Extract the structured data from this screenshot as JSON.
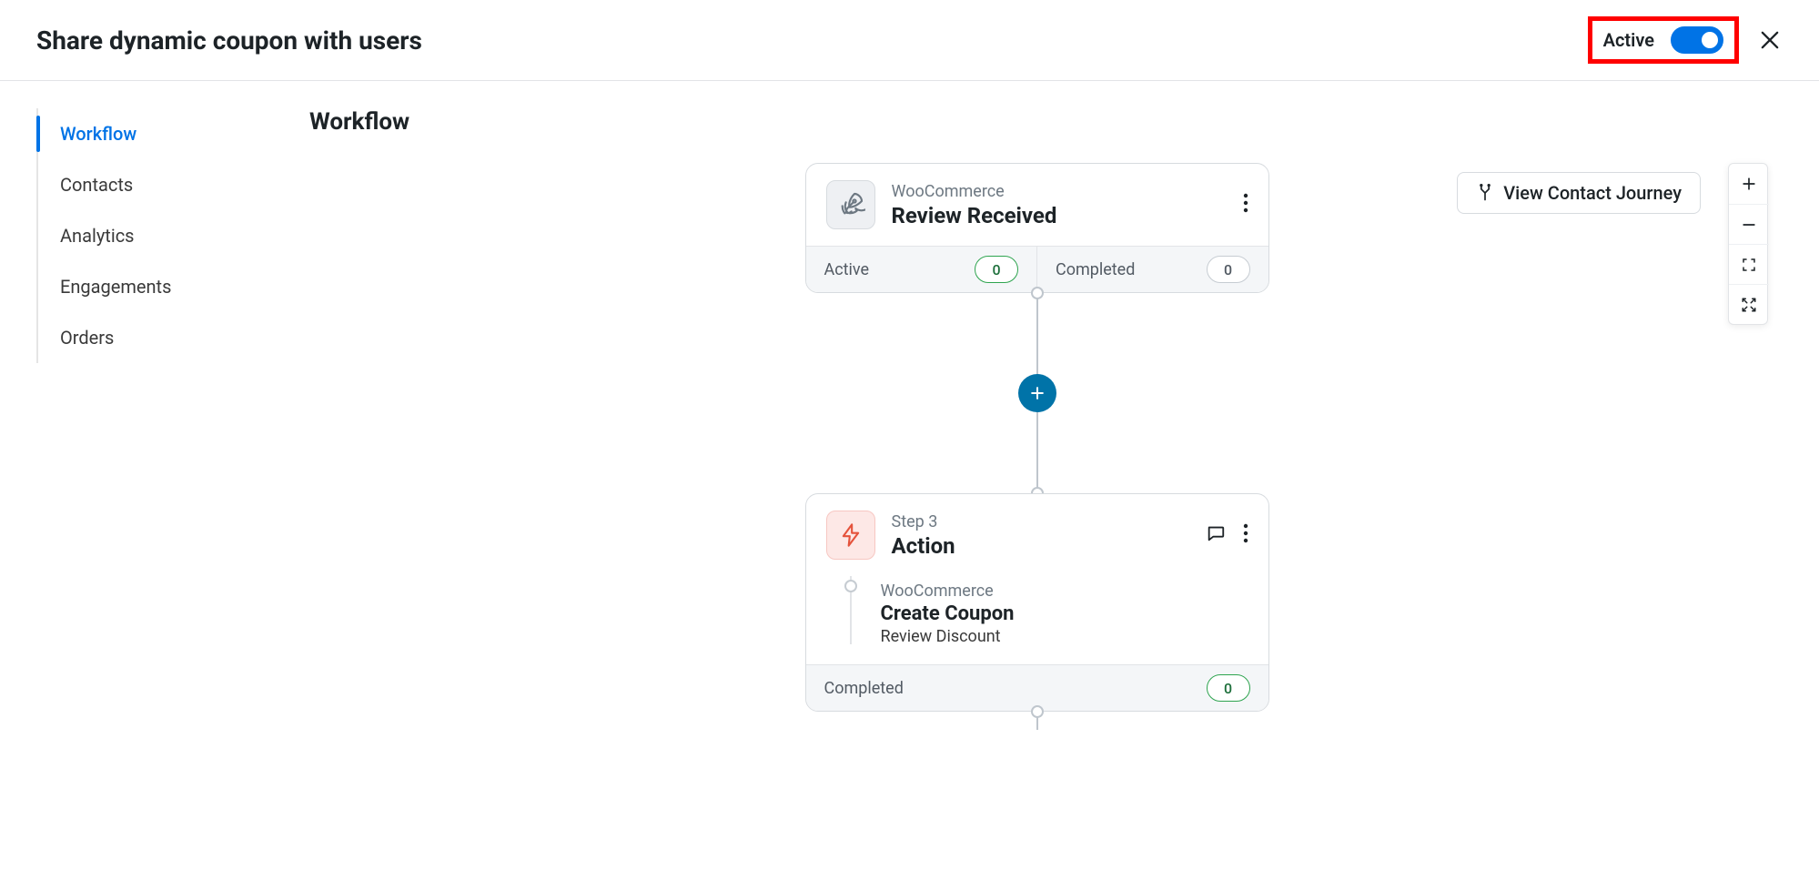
{
  "header": {
    "title": "Share dynamic coupon with users",
    "active_label": "Active"
  },
  "sidebar": {
    "items": [
      {
        "label": "Workflow",
        "active": true
      },
      {
        "label": "Contacts"
      },
      {
        "label": "Analytics"
      },
      {
        "label": "Engagements"
      },
      {
        "label": "Orders"
      }
    ]
  },
  "main": {
    "title": "Workflow",
    "journey_button": "View Contact Journey"
  },
  "trigger_node": {
    "subtitle": "WooCommerce",
    "title": "Review Received",
    "footer": {
      "active_label": "Active",
      "active_count": "0",
      "completed_label": "Completed",
      "completed_count": "0"
    }
  },
  "action_node": {
    "subtitle": "Step 3",
    "title": "Action",
    "step": {
      "sub": "WooCommerce",
      "title": "Create Coupon",
      "desc": "Review Discount"
    },
    "footer": {
      "completed_label": "Completed",
      "completed_count": "0"
    }
  },
  "icons": {
    "close": "close-icon",
    "rocket": "rocket-icon",
    "bolt": "bolt-icon",
    "dots": "dots-vertical-icon",
    "chat": "chat-icon",
    "split": "split-icon",
    "plus": "plus-icon",
    "minus": "minus-icon",
    "fit": "fit-screen-icon",
    "full": "fullscreen-icon"
  }
}
